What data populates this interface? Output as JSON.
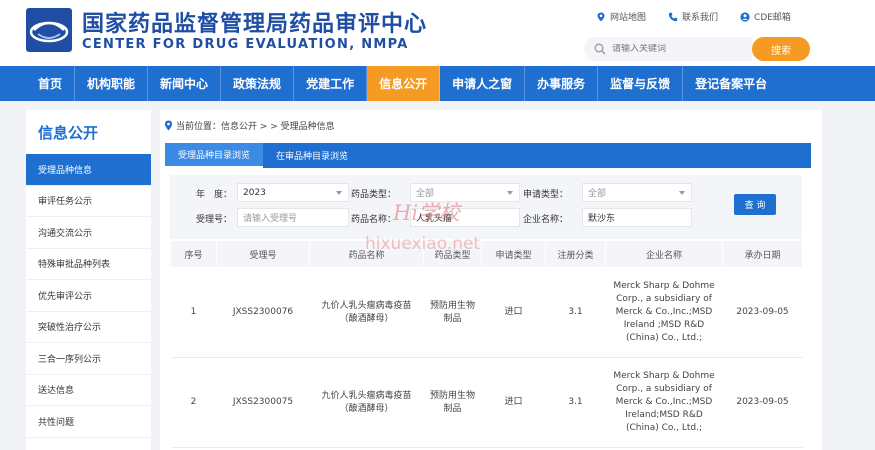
{
  "header": {
    "logo_icon": "nmpa-logo-icon",
    "title_cn": "国家药品监督管理局药品审评中心",
    "title_en": "CENTER FOR DRUG EVALUATION, NMPA",
    "links": [
      {
        "icon": "location-pin-icon",
        "label": "网站地图"
      },
      {
        "icon": "phone-icon",
        "label": "联系我们"
      },
      {
        "icon": "user-icon",
        "label": "CDE邮箱"
      }
    ],
    "search": {
      "placeholder": "请输入关键词",
      "button_label": "搜索"
    }
  },
  "nav": {
    "items": [
      "首页",
      "机构职能",
      "新闻中心",
      "政策法规",
      "党建工作",
      "信息公开",
      "申请人之窗",
      "办事服务",
      "监督与反馈",
      "登记备案平台"
    ],
    "active_index": 5,
    "color": "#1f6fd1",
    "active_color": "#f59a23"
  },
  "sidebar": {
    "title": "信息公开",
    "items": [
      "受理品种信息",
      "审评任务公示",
      "沟通交流公示",
      "特殊审批品种列表",
      "优先审评公示",
      "突破性治疗公示",
      "三合一序列公示",
      "送达信息",
      "共性问题"
    ],
    "active_index": 0
  },
  "breadcrumb": {
    "icon": "location-pin-icon",
    "text": "当前位置：信息公开 > > 受理品种信息"
  },
  "tabs": {
    "items": [
      "受理品种目录浏览",
      "在审品种目录浏览"
    ],
    "active_index": 0
  },
  "filters": {
    "year": {
      "label": "年　度：",
      "value": "2023"
    },
    "drug_type": {
      "label": "药品类型：",
      "value": "全部"
    },
    "apply_type": {
      "label": "申请类型：",
      "value": "全部"
    },
    "accept_no": {
      "label": "受理号：",
      "placeholder": "请输入受理号"
    },
    "drug_name": {
      "label": "药品名称：",
      "value": "人乳头瘤"
    },
    "company": {
      "label": "企业名称：",
      "value": "默沙东"
    },
    "query_label": "查 询"
  },
  "table": {
    "headers": [
      "序号",
      "受理号",
      "药品名称",
      "药品类型",
      "申请类型",
      "注册分类",
      "企业名称",
      "承办日期"
    ],
    "rows": [
      [
        "1",
        "JXSS2300076",
        "九价人乳头瘤病毒疫苗（酿酒酵母）",
        "预防用生物制品",
        "进口",
        "3.1",
        "Merck Sharp & Dohme Corp., a subsidiary of Merck & Co.,Inc.;MSD Ireland ;MSD R&D (China) Co., Ltd.;",
        "2023-09-05"
      ],
      [
        "2",
        "JXSS2300075",
        "九价人乳头瘤病毒疫苗（酿酒酵母）",
        "预防用生物制品",
        "进口",
        "3.1",
        "Merck Sharp & Dohme Corp., a subsidiary of Merck & Co.,Inc.;MSD Ireland;MSD R&D (China) Co., Ltd.;",
        "2023-09-05"
      ]
    ]
  },
  "watermark": {
    "line1": "Hi学校",
    "line2": "hixuexiao.net"
  }
}
